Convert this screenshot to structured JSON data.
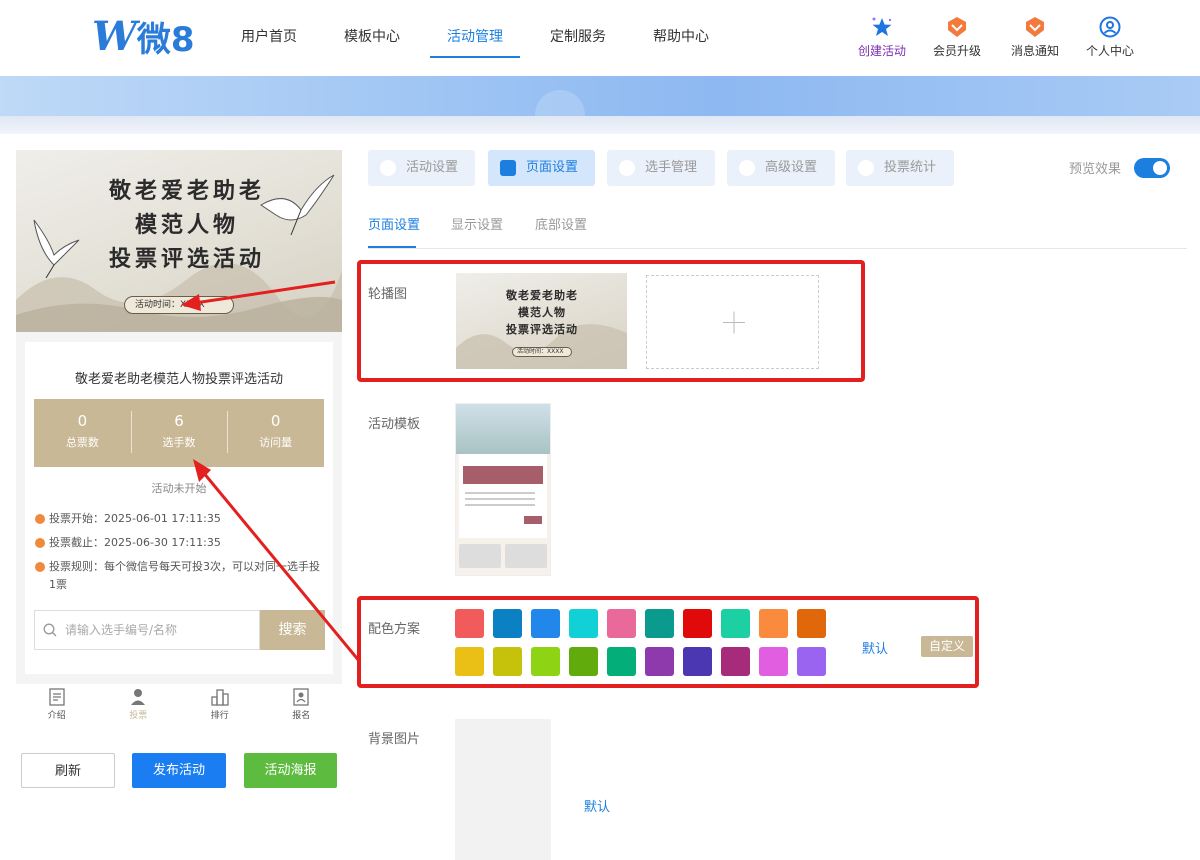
{
  "logo": {
    "mark": "W",
    "text": "微8"
  },
  "nav": {
    "items": [
      {
        "label": "用户首页"
      },
      {
        "label": "模板中心"
      },
      {
        "label": "活动管理"
      },
      {
        "label": "定制服务"
      },
      {
        "label": "帮助中心"
      }
    ],
    "active_index": 2
  },
  "tools": [
    {
      "label": "创建活动",
      "icon": "star-sparkle-icon"
    },
    {
      "label": "会员升级",
      "icon": "vip-badge-icon"
    },
    {
      "label": "消息通知",
      "icon": "bell-badge-icon"
    },
    {
      "label": "个人中心",
      "icon": "user-circle-icon"
    }
  ],
  "preview": {
    "cover_title_lines": [
      "敬老爱老助老",
      "模范人物",
      "投票评选活动"
    ],
    "cover_time": "活动时间：XXXX",
    "activity_title": "敬老爱老助老模范人物投票评选活动",
    "stats": [
      {
        "value": "0",
        "label": "总票数"
      },
      {
        "value": "6",
        "label": "选手数"
      },
      {
        "value": "0",
        "label": "访问量"
      }
    ],
    "status": "活动未开始",
    "rules": [
      "投票开始：2025-06-01 17:11:35",
      "投票截止：2025-06-30 17:11:35",
      "投票规则：每个微信号每天可投3次，可以对同一选手投1票"
    ],
    "search": {
      "placeholder": "请输入选手编号/名称",
      "button": "搜索"
    },
    "tabbar": [
      {
        "label": "介绍",
        "icon": "document-icon"
      },
      {
        "label": "投票",
        "icon": "person-icon"
      },
      {
        "label": "排行",
        "icon": "bar-rank-icon"
      },
      {
        "label": "报名",
        "icon": "signup-icon"
      }
    ]
  },
  "actions": {
    "refresh": "刷新",
    "publish": "发布活动",
    "poster": "活动海报"
  },
  "segments": [
    {
      "label": "活动设置",
      "icon": "shield-icon"
    },
    {
      "label": "页面设置",
      "icon": "layout-icon"
    },
    {
      "label": "选手管理",
      "icon": "user-icon"
    },
    {
      "label": "高级设置",
      "icon": "percent-icon"
    },
    {
      "label": "投票统计",
      "icon": "chart-icon"
    }
  ],
  "preview_toggle": {
    "label": "预览效果",
    "on": true
  },
  "subtabs": [
    {
      "label": "页面设置"
    },
    {
      "label": "显示设置"
    },
    {
      "label": "底部设置"
    }
  ],
  "fields": {
    "carousel": "轮播图",
    "template": "活动模板",
    "color_scheme": "配色方案",
    "background": "背景图片"
  },
  "carousel_thumb": {
    "title_lines": [
      "敬老爱老助老",
      "模范人物",
      "投票评选活动"
    ],
    "time": "活动时间：XXXX"
  },
  "color_swatches": [
    [
      "#f25b5b",
      "#0b80c3",
      "#2187ea",
      "#12d1d6",
      "#e8699a",
      "#0a9a8e",
      "#e10a0a",
      "#1dd0a3",
      "#f98a3e",
      "#e0680a"
    ],
    [
      "#ebc016",
      "#c6c10a",
      "#8ed314",
      "#62ab0c",
      "#04ae78",
      "#8e3aac",
      "#4c37b2",
      "#a62b7a",
      "#e25ee0",
      "#9a63f0"
    ]
  ],
  "color_default": "默认",
  "color_custom": "自定义",
  "background_default": "默认"
}
